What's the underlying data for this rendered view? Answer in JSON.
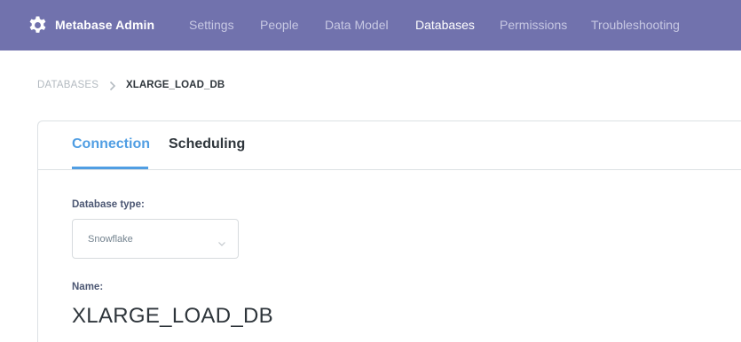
{
  "nav": {
    "brand_label": "Metabase Admin",
    "brand_icon": "gear-icon",
    "items": [
      {
        "label": "Settings",
        "active": false
      },
      {
        "label": "People",
        "active": false
      },
      {
        "label": "Data Model",
        "active": false
      },
      {
        "label": "Databases",
        "active": true
      },
      {
        "label": "Permissions",
        "active": false
      },
      {
        "label": "Troubleshooting",
        "active": false
      }
    ]
  },
  "breadcrumb": {
    "parent": "DATABASES",
    "separator_icon": "chevron-right-icon",
    "current": "XLARGE_LOAD_DB"
  },
  "tabs": [
    {
      "label": "Connection",
      "active": true
    },
    {
      "label": "Scheduling",
      "active": false
    }
  ],
  "form": {
    "database_type_label": "Database type:",
    "database_type_value": "Snowflake",
    "name_label": "Name:",
    "name_value": "XLARGE_LOAD_DB"
  },
  "colors": {
    "nav_background": "#7172ad",
    "accent": "#509ee3",
    "text_dark": "#2e353b"
  }
}
